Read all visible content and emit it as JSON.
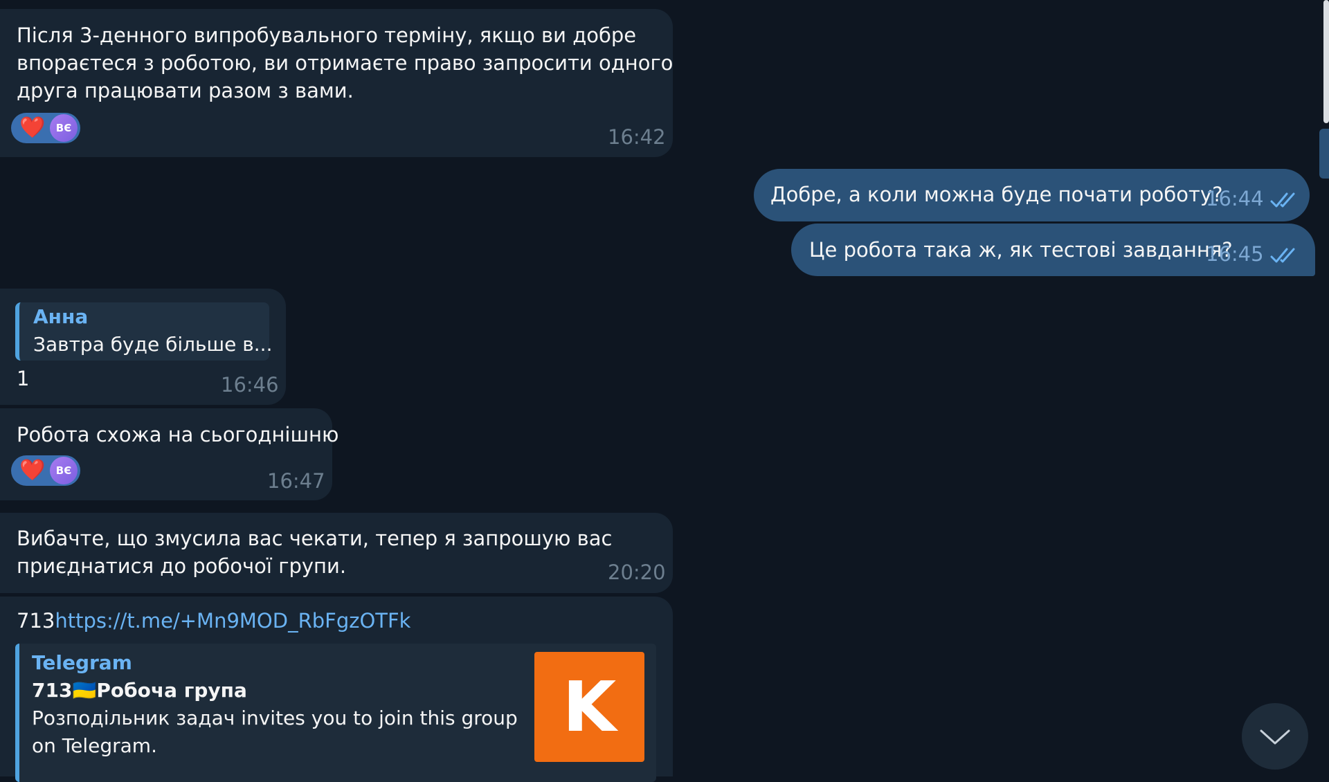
{
  "messages": [
    {
      "text_lines": [
        "Після 3-денного випробувального терміну, якщо ви добре",
        "впораєтеся з роботою, ви отримаєте право запросити одного",
        "друга працювати разом з вами."
      ],
      "time": "16:42",
      "reaction": {
        "emoji": "❤️",
        "avatar": "ВЄ"
      }
    },
    {
      "text": "Добре, а коли можна буде почати роботу?",
      "time": "16:44"
    },
    {
      "text": "Це робота така ж, як тестові завдання?",
      "time": "16:45"
    },
    {
      "reply_author": "Анна",
      "reply_text": "Завтра буде більше в...",
      "text": "1",
      "time": "16:46"
    },
    {
      "text": "Робота схожа на сьогоднішню",
      "time": "16:47",
      "reaction": {
        "emoji": "❤️",
        "avatar": "ВЄ"
      }
    },
    {
      "text_lines": [
        "Вибачте, що змусила вас чекати, тепер я запрошую вас",
        "приєднатися до робочої групи."
      ],
      "time": "20:20"
    },
    {
      "prefix": "713",
      "link": "https://t.me/+Mn9MOD_RbFgzOTFk",
      "preview": {
        "site": "Telegram",
        "title_prefix": "713",
        "flag": "🇺🇦",
        "title": "Робоча група",
        "desc_lines": [
          "Розподільник задач invites you to join this group",
          "on Telegram."
        ],
        "thumb_letter": "K"
      }
    }
  ],
  "icons": {
    "read_checks": "double-check-icon",
    "scroll_down": "chevron-down-icon"
  },
  "colors": {
    "background": "#0e1621",
    "incoming": "#182533",
    "outgoing": "#2b5278",
    "link": "#6ab3f3",
    "thumb": "#f26d12"
  }
}
